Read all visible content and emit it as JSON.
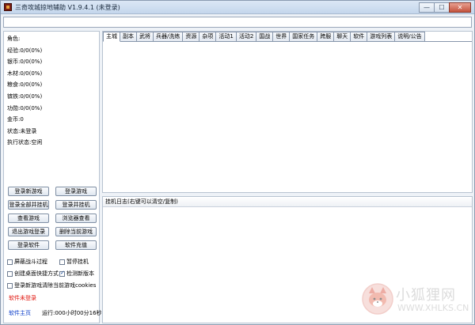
{
  "window": {
    "title": "三奇攻城掠地辅助 V1.9.4.1 (未登录)",
    "controls": {
      "minimize": "—",
      "maximize": "☐",
      "close": "✕"
    }
  },
  "stats": [
    "角色:",
    "经验:0/0(0%)",
    "银币:0/0(0%)",
    "木材:0/0(0%)",
    "粮食:0/0(0%)",
    "镔铁:0/0(0%)",
    "功勋:0/0(0%)",
    "金币:0",
    "状态:未登录",
    "执行状态:空闲"
  ],
  "buttons": {
    "login_new_game": "登录新游戏",
    "login_game": "登录游戏",
    "login_all_hang": "登录全部并挂机",
    "login_hang": "登录并挂机",
    "view_game": "查看游戏",
    "browser_view": "浏览器查看",
    "logout_game": "退出游戏登录",
    "delete_current": "删除当前游戏",
    "login_software": "登录软件",
    "software_recharge": "软件充值"
  },
  "checkboxes": {
    "hide_battle": {
      "label": "屏蔽战斗过程",
      "checked": false
    },
    "pause_hang": {
      "label": "暂停挂机",
      "checked": false
    },
    "create_shortcut": {
      "label": "创建桌面快捷方式",
      "checked": false
    },
    "check_update": {
      "label": "检测新版本",
      "checked": true
    },
    "clear_cookies": {
      "label": "登录新游戏清除当前游戏cookies",
      "checked": false
    }
  },
  "status": {
    "unregistered": "软件未登录",
    "home_link": "软件主页",
    "runtime": "运行:000小时00分16秒"
  },
  "tabs": [
    "主城",
    "副本",
    "武将",
    "兵器/洗练",
    "资源",
    "杂项",
    "活动1",
    "活动2",
    "国战",
    "世界",
    "国家任务",
    "跨服",
    "聊天",
    "软件",
    "游戏列表",
    "说明/公告"
  ],
  "active_tab": "主城",
  "log": {
    "header": "挂机日志(右键可以清空/复制)"
  },
  "watermark": {
    "cn": "小狐狸网",
    "en": "WWW.XHLKS.CN"
  },
  "icons": [
    "app-icon",
    "fox-logo-icon"
  ]
}
